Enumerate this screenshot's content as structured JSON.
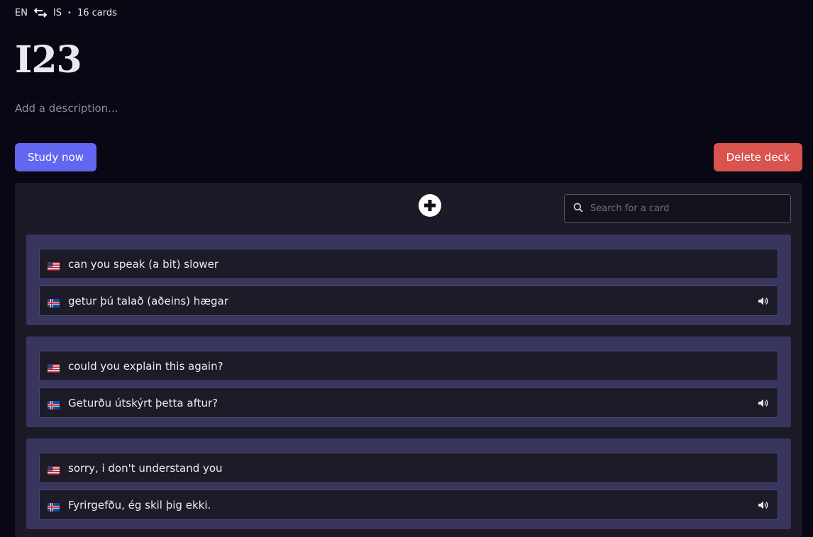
{
  "deck": {
    "source_lang": "EN",
    "target_lang": "IS",
    "swap_icon": "swap-arrows-icon",
    "separator": "•",
    "card_count": "16 cards",
    "title": "I23",
    "description_placeholder": "Add a description..."
  },
  "actions": {
    "study_label": "Study now",
    "delete_label": "Delete deck",
    "study_color": "#6366f1",
    "delete_color": "#d9534f"
  },
  "toolbar": {
    "add_icon": "plus-circle-icon",
    "search_placeholder": "Search for a card",
    "search_icon": "search-icon"
  },
  "cards": [
    {
      "front_flag": "us-flag-icon",
      "front": "can you speak (a bit) slower",
      "back_flag": "iceland-flag-icon",
      "back": "getur þú talað (aðeins) hægar",
      "audio_icon": "speaker-icon"
    },
    {
      "front_flag": "us-flag-icon",
      "front": "could you explain this again?",
      "back_flag": "iceland-flag-icon",
      "back": "Geturðu útskýrt þetta aftur?",
      "audio_icon": "speaker-icon"
    },
    {
      "front_flag": "us-flag-icon",
      "front": "sorry, i don't understand you",
      "back_flag": "iceland-flag-icon",
      "back": "Fyrirgefðu, ég skil þig ekki.",
      "audio_icon": "speaker-icon"
    }
  ],
  "colors": {
    "background": "#080713",
    "panel": "#1b1a26",
    "card": "#38355f",
    "field": "#1c1b27"
  }
}
